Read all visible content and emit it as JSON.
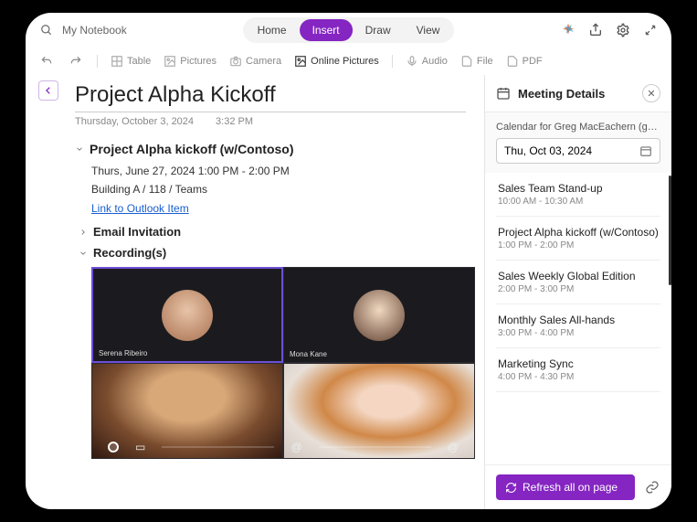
{
  "header": {
    "notebook_name": "My Notebook",
    "tabs": [
      "Home",
      "Insert",
      "Draw",
      "View"
    ],
    "active_tab_index": 1
  },
  "ribbon": {
    "table": "Table",
    "pictures": "Pictures",
    "camera": "Camera",
    "online_pictures": "Online Pictures",
    "audio": "Audio",
    "file": "File",
    "pdf": "PDF"
  },
  "page": {
    "title": "Project Alpha Kickoff",
    "date": "Thursday, October 3, 2024",
    "time": "3:32 PM",
    "meeting_heading": "Project Alpha kickoff (w/Contoso)",
    "meeting_time": "Thurs, June 27, 2024 1:00 PM - 2:00 PM",
    "meeting_location": "Building A / 118 / Teams",
    "meeting_link_label": "Link to Outlook Item",
    "email_invitation_label": "Email Invitation",
    "recordings_label": "Recording(s)",
    "participants": [
      "Serena Ribeiro",
      "Mona Kane"
    ]
  },
  "panel": {
    "title": "Meeting Details",
    "calendar_for": "Calendar for Greg MacEachern (gmaceach...",
    "date_value": "Thu, Oct 03, 2024",
    "meetings": [
      {
        "title": "Sales Team Stand-up",
        "time": "10:00 AM - 10:30 AM"
      },
      {
        "title": "Project Alpha kickoff (w/Contoso)",
        "time": "1:00 PM - 2:00 PM"
      },
      {
        "title": "Sales Weekly Global Edition",
        "time": "2:00 PM - 3:00 PM"
      },
      {
        "title": "Monthly Sales All-hands",
        "time": "3:00 PM - 4:00 PM"
      },
      {
        "title": "Marketing Sync",
        "time": "4:00 PM - 4:30 PM"
      }
    ],
    "refresh_label": "Refresh all on page"
  },
  "colors": {
    "accent": "#8525c2"
  }
}
